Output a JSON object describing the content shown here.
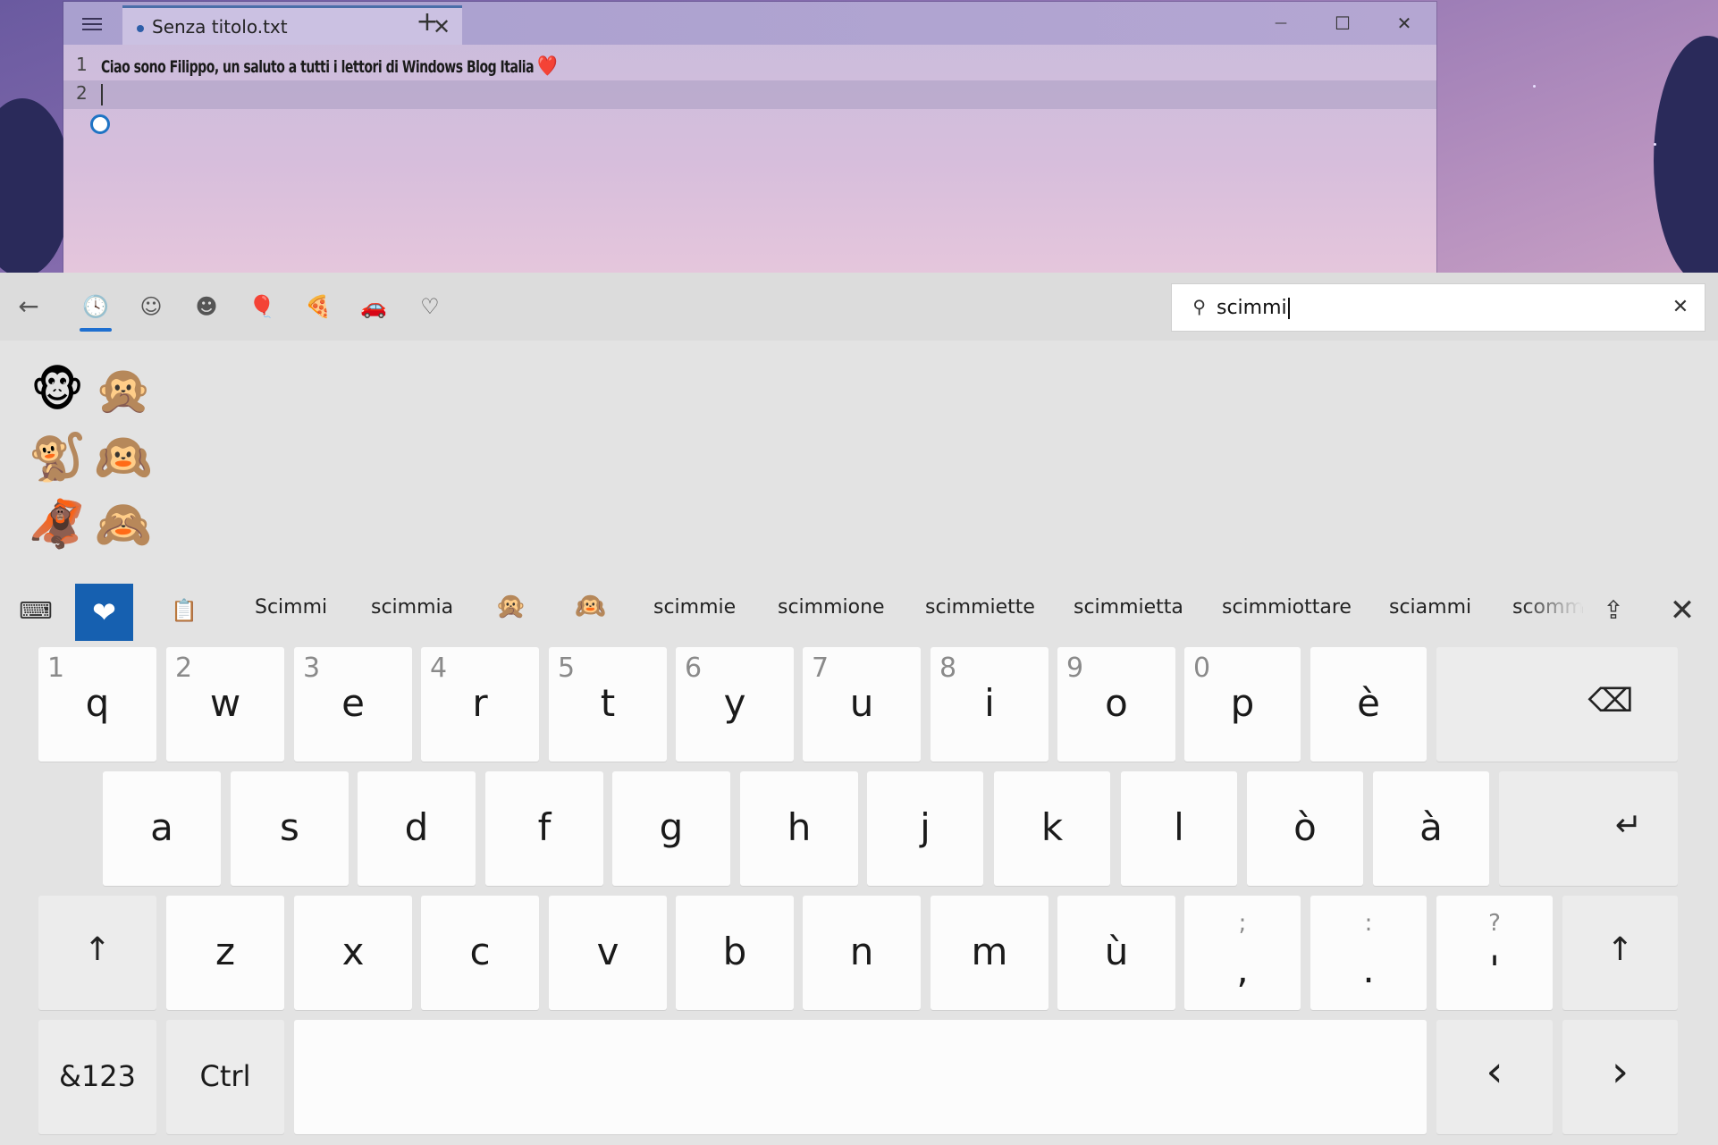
{
  "notepad": {
    "tab_title": "Senza titolo.txt",
    "close_tab_glyph": "✕",
    "new_tab_glyph": "+",
    "minimize_glyph": "—",
    "maximize_glyph": "☐",
    "close_glyph": "✕",
    "lines": [
      {
        "number": "1",
        "text": "Ciao sono Filippo, un saluto a tutti i lettori di Windows Blog Italia",
        "emoji": "❤️"
      },
      {
        "number": "2",
        "text": ""
      }
    ]
  },
  "emoji_panel": {
    "back_glyph": "←",
    "categories": [
      {
        "name": "recent-icon",
        "glyph": "🕓"
      },
      {
        "name": "smiley-icon",
        "glyph": "☺"
      },
      {
        "name": "people-icon",
        "glyph": "☻"
      },
      {
        "name": "celebration-icon",
        "glyph": "🎈"
      },
      {
        "name": "food-icon",
        "glyph": "🍕"
      },
      {
        "name": "travel-icon",
        "glyph": "🚗"
      },
      {
        "name": "heart-icon",
        "glyph": "♡"
      }
    ],
    "search": {
      "icon": "⚲",
      "value": "scimmi",
      "clear_glyph": "✕"
    },
    "results": [
      "🐵",
      "🙊",
      "🐒",
      "🙉",
      "🦧",
      "🙈"
    ]
  },
  "candidates": {
    "settings_glyph": "⌨",
    "emoji_toggle_glyph": "❤",
    "clipboard_glyph": "📋",
    "items": [
      {
        "type": "text",
        "value": "Scimmi"
      },
      {
        "type": "text",
        "value": "scimmia"
      },
      {
        "type": "emoji",
        "value": "🙊"
      },
      {
        "type": "emoji",
        "value": "🙉"
      },
      {
        "type": "text",
        "value": "scimmie"
      },
      {
        "type": "text",
        "value": "scimmione"
      },
      {
        "type": "text",
        "value": "scimmiette"
      },
      {
        "type": "text",
        "value": "scimmietta"
      },
      {
        "type": "text",
        "value": "scimmiottare"
      },
      {
        "type": "text",
        "value": "sciammi"
      },
      {
        "type": "text",
        "value": "scomm"
      }
    ],
    "undock_glyph": "⇪",
    "close_glyph": "✕"
  },
  "keyboard": {
    "row1": [
      {
        "hint": "1",
        "key": "q"
      },
      {
        "hint": "2",
        "key": "w"
      },
      {
        "hint": "3",
        "key": "e"
      },
      {
        "hint": "4",
        "key": "r"
      },
      {
        "hint": "5",
        "key": "t"
      },
      {
        "hint": "6",
        "key": "y"
      },
      {
        "hint": "7",
        "key": "u"
      },
      {
        "hint": "8",
        "key": "i"
      },
      {
        "hint": "9",
        "key": "o"
      },
      {
        "hint": "0",
        "key": "p"
      },
      {
        "hint": "",
        "key": "è"
      }
    ],
    "backspace_glyph": "⌫",
    "row2": [
      "a",
      "s",
      "d",
      "f",
      "g",
      "h",
      "j",
      "k",
      "l",
      "ò",
      "à"
    ],
    "enter_glyph": "↵",
    "shift_glyph": "↑",
    "row3": [
      "z",
      "x",
      "c",
      "v",
      "b",
      "n",
      "m",
      "ù"
    ],
    "punct": [
      {
        "top": ";",
        "bottom": ","
      },
      {
        "top": ":",
        "bottom": "."
      },
      {
        "top": "?",
        "bottom": "'"
      }
    ],
    "sym_label": "&123",
    "ctrl_label": "Ctrl",
    "left_glyph": "‹",
    "right_glyph": "›"
  }
}
